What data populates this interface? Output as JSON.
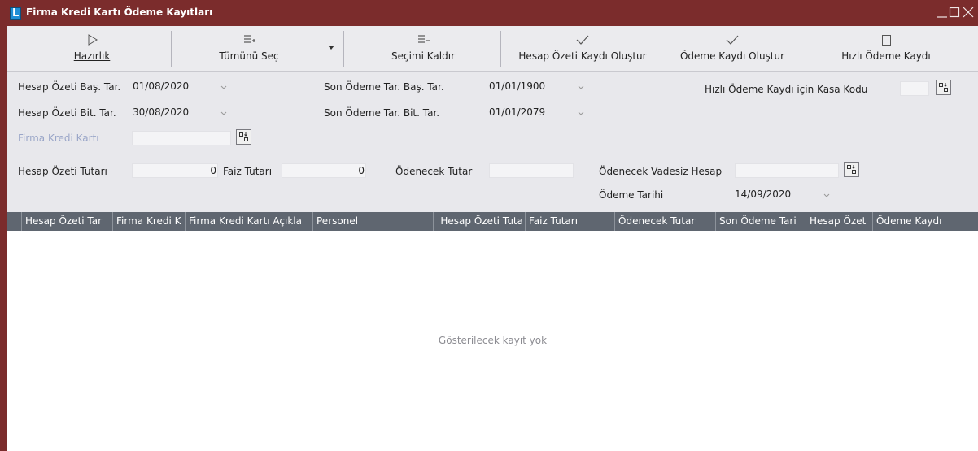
{
  "window": {
    "title": "Firma Kredi Kartı Ödeme Kayıtları",
    "logo_letter": "L"
  },
  "toolbar": {
    "hazirlik": "Hazırlık",
    "tumunu_sec": "Tümünü Seç",
    "secimi_kaldir": "Seçimi Kaldır",
    "hesap_ozeti_kaydi_olustur": "Hesap Özeti Kaydı Oluştur",
    "odeme_kaydi_olustur": "Ödeme Kaydı Oluştur",
    "hizli_odeme_kaydi": "Hızlı Ödeme Kaydı"
  },
  "filters": {
    "hesap_ozeti_bas_tar": {
      "label": "Hesap Özeti Baş. Tar.",
      "value": "01/08/2020"
    },
    "hesap_ozeti_bit_tar": {
      "label": "Hesap Özeti Bit. Tar.",
      "value": "30/08/2020"
    },
    "firma_kredi_karti": {
      "label": "Firma Kredi Kartı",
      "value": ""
    },
    "son_odeme_tar_bas": {
      "label": "Son Ödeme Tar. Baş. Tar.",
      "value": "01/01/1900"
    },
    "son_odeme_tar_bit": {
      "label": "Son Ödeme Tar. Bit. Tar.",
      "value": "01/01/2079"
    },
    "kasa_kodu": {
      "label": "Hızlı Ödeme Kaydı için Kasa Kodu",
      "value": ""
    }
  },
  "totals": {
    "hesap_ozeti_tutari": {
      "label": "Hesap Özeti Tutarı",
      "value": "0"
    },
    "faiz_tutari": {
      "label": "Faiz Tutarı",
      "value": "0"
    },
    "odenecek_tutar": {
      "label": "Ödenecek Tutar",
      "value": ""
    },
    "odenecek_vadesiz_hesap": {
      "label": "Ödenecek Vadesiz Hesap",
      "value": ""
    },
    "odeme_tarihi": {
      "label": "Ödeme Tarihi",
      "value": "14/09/2020"
    }
  },
  "grid": {
    "columns": [
      "Hesap Özeti Tar",
      "Firma Kredi K",
      "Firma Kredi Kartı Açıkla",
      "Personel",
      "Hesap Özeti Tuta",
      "Faiz Tutarı",
      "Ödenecek Tutar",
      "Son Ödeme Tari",
      "Hesap Özet",
      "Ödeme Kaydı"
    ],
    "empty_text": "Gösterilecek kayıt yok"
  },
  "colors": {
    "titlebar": "#7b2c2c",
    "panel": "#e8e8ec",
    "grid_header": "#5f6670"
  }
}
